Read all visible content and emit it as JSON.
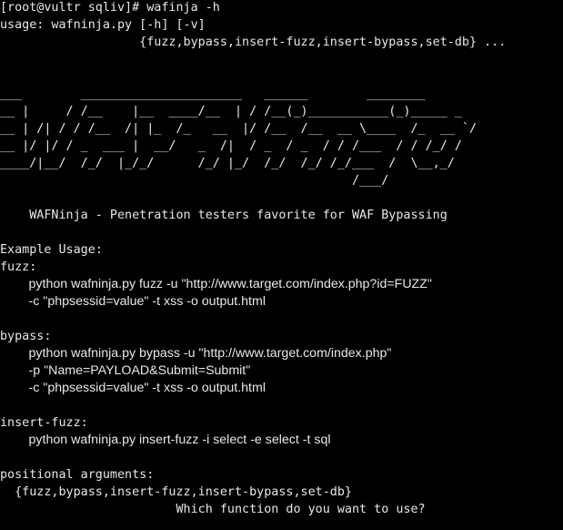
{
  "terminal": {
    "colors": {
      "background": "#000000",
      "foreground": "#e8e8e8"
    },
    "lines": [
      "[root@vultr sqliv]# wafinja -h",
      "usage: wafninja.py [-h] [-v]",
      "                   {fuzz,bypass,insert-fuzz,insert-bypass,set-db} ...",
      "",
      "",
      "___        ______________________   ______        ________",
      "__ |     / /__    |__  ____/__  | / /__(_)___________(_)_____ _",
      "__ | /| / / /__  /| |_  /_   __  |/ /__  /__  __ \\____  /_  __ `/",
      "__ |/ |/ / _  ___ |  __/   _  /|  / _  / _  / / /___  / / /_/ /",
      "____/|__/  /_/  |_/_/      /_/ |_/  /_/  /_/ /_/___  /  \\__,_/",
      "                                                /___/",
      "",
      "    WAFNinja - Penetration testers favorite for WAF Bypassing",
      "",
      "Example Usage:",
      "fuzz:",
      "        python wafninja.py fuzz -u \"http://www.target.com/index.php?id=FUZZ\"",
      "        -c \"phpsessid=value\" -t xss -o output.html",
      "",
      "bypass:",
      "        python wafninja.py bypass -u \"http://www.target.com/index.php\"",
      "        -p \"Name=PAYLOAD&Submit=Submit\"",
      "        -c \"phpsessid=value\" -t xss -o output.html",
      "",
      "insert-fuzz:",
      "        python wafninja.py insert-fuzz -i select -e select -t sql",
      "",
      "positional arguments:",
      "  {fuzz,bypass,insert-fuzz,insert-bypass,set-db}",
      "                        Which function do you want to use?"
    ]
  }
}
